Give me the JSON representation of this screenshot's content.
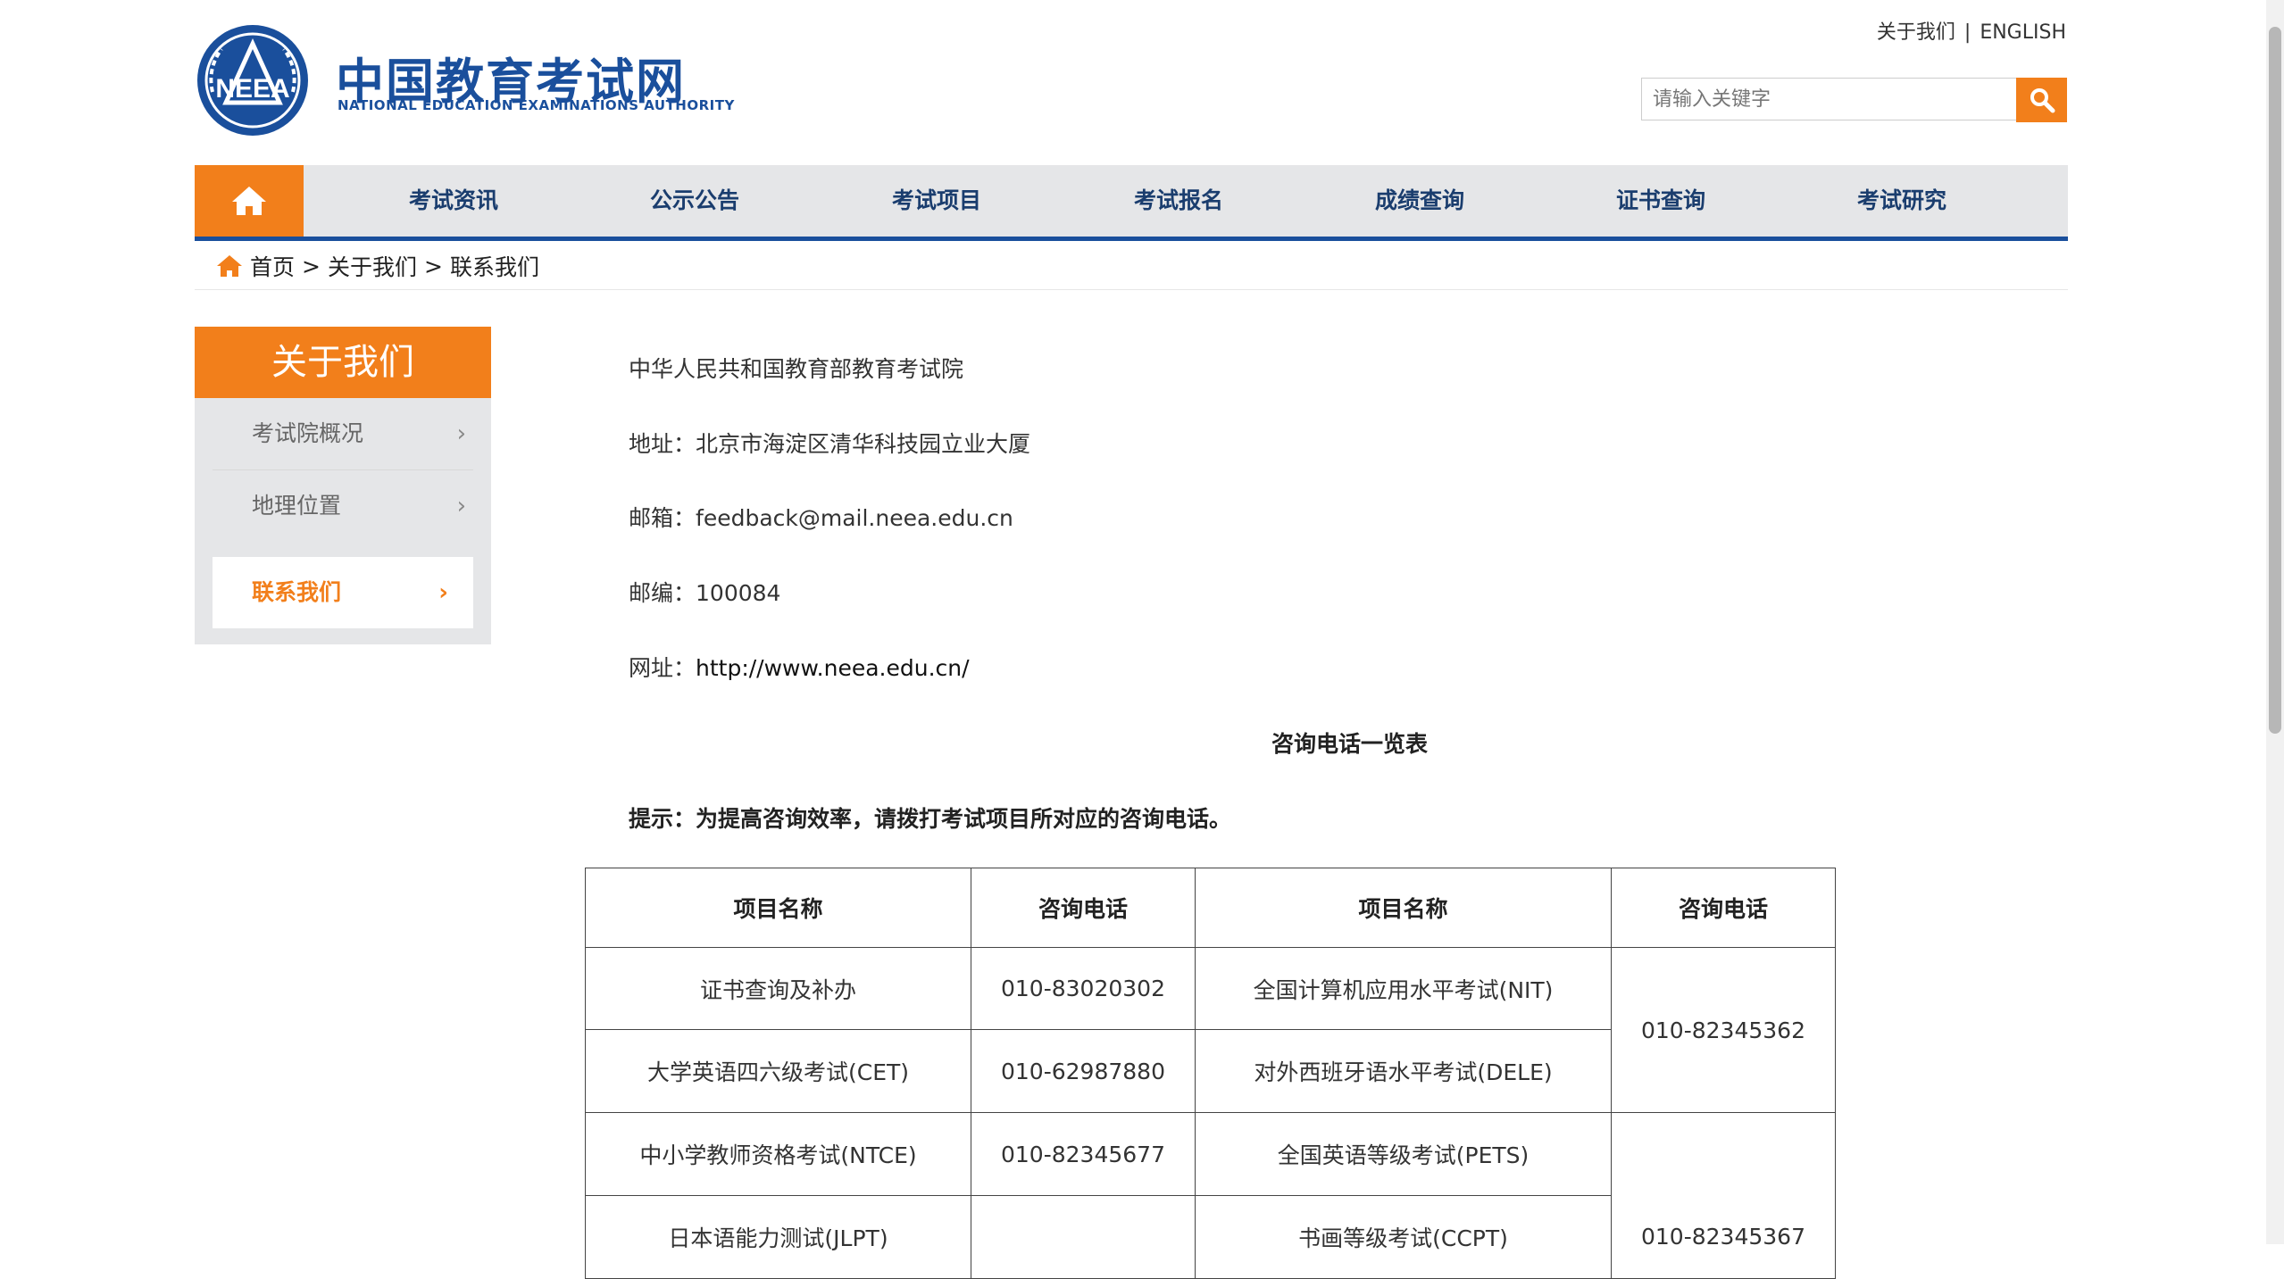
{
  "header": {
    "logo_title": "中国教育考试网",
    "logo_subtitle": "NATIONAL EDUCATION EXAMINATIONS AUTHORITY",
    "logo_emblem_text": "NEEA",
    "top_links": [
      "关于我们",
      "ENGLISH"
    ],
    "top_sep": "|",
    "search_placeholder": "请输入关键字",
    "search_icon": "search-icon"
  },
  "nav": {
    "home_icon": "home-icon",
    "items": [
      "考试资讯",
      "公示公告",
      "考试项目",
      "考试报名",
      "成绩查询",
      "证书查询",
      "考试研究"
    ]
  },
  "breadcrumb": {
    "icon": "home-icon",
    "items": [
      "首页",
      "关于我们",
      "联系我们"
    ],
    "separator": ">"
  },
  "sidebar": {
    "title": "关于我们",
    "items": [
      {
        "label": "考试院概况",
        "active": false
      },
      {
        "label": "地理位置",
        "active": false
      },
      {
        "label": "联系我们",
        "active": true
      }
    ]
  },
  "content": {
    "org_name": "中华人民共和国教育部教育考试院",
    "address_label": "地址：",
    "address": "北京市海淀区清华科技园立业大厦",
    "email_label": "邮箱：",
    "email": "feedback@mail.neea.edu.cn",
    "postcode_label": "邮编：",
    "postcode": "100084",
    "website_label": "网址：",
    "website": "http://www.neea.edu.cn/",
    "table_title": "咨询电话一览表",
    "tip": "提示：为提高咨询效率，请拨打考试项目所对应的咨询电话。"
  },
  "phone_table": {
    "headers": [
      "项目名称",
      "咨询电话",
      "项目名称",
      "咨询电话"
    ],
    "rows": [
      {
        "left_name": "证书查询及补办",
        "left_phone": "010-83020302",
        "right_name": "全国计算机应用水平考试(NIT)"
      },
      {
        "left_name": "大学英语四六级考试(CET)",
        "left_phone": "010-62987880",
        "right_name": "对外西班牙语水平考试(DELE)"
      },
      {
        "left_name": "中小学教师资格考试(NTCE)",
        "left_phone": "010-82345677",
        "right_name": "全国英语等级考试(PETS)"
      },
      {
        "left_name": "日本语能力测试(JLPT)",
        "left_phone": "",
        "right_name": "书画等级考试(CCPT)"
      }
    ],
    "merged_phones": [
      "010-82345362",
      "010-82345367"
    ]
  },
  "colors": {
    "accent": "#f27f1b",
    "brand_blue": "#1a4f9c",
    "nav_bg": "#e5e6e8"
  }
}
